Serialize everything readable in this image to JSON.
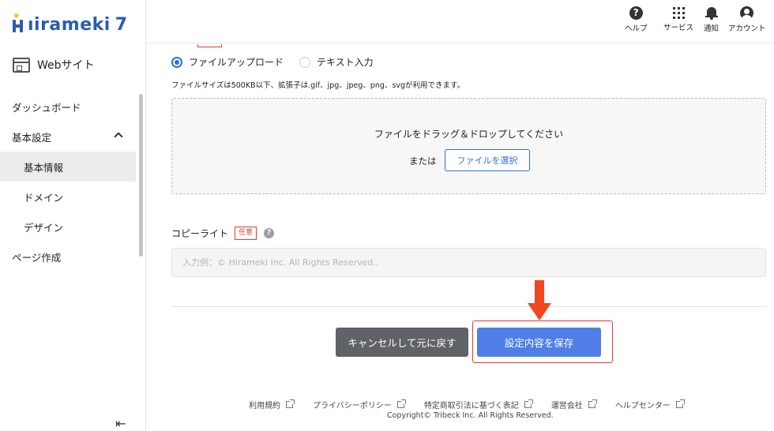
{
  "brand": {
    "logo_text": "ıirameki",
    "logo_number": "7"
  },
  "sidebar": {
    "site_label": "Webサイト",
    "items": [
      {
        "label": "ダッシュボード"
      },
      {
        "label": "基本設定"
      },
      {
        "label": "基本情報"
      },
      {
        "label": "ドメイン"
      },
      {
        "label": "デザイン"
      },
      {
        "label": "ページ作成"
      }
    ],
    "collapse_glyph": "⇤"
  },
  "header": {
    "actions": [
      {
        "label": "ヘルプ",
        "icon": "help-icon"
      },
      {
        "label": "サービス",
        "icon": "grid-icon"
      },
      {
        "label": "通知",
        "icon": "bell-icon"
      },
      {
        "label": "アカウント",
        "icon": "account-icon"
      }
    ]
  },
  "upload": {
    "option_file": "ファイルアップロード",
    "option_text": "テキスト入力",
    "selected": "ファイルアップロード",
    "note": "ファイルサイズは500KB以下、拡張子は.gif、jpg、jpeg、png、svgが利用できます。",
    "drop_title": "ファイルをドラッグ＆ドロップしてください",
    "or_text": "または",
    "select_button": "ファイルを選択"
  },
  "copyright_field": {
    "label": "コピーライト",
    "badge": "任意",
    "help_glyph": "?",
    "placeholder": "入力例：© Hirameki Inc. All Rights Reserved..",
    "value": ""
  },
  "actions": {
    "cancel": "キャンセルして元に戻す",
    "save": "設定内容を保存"
  },
  "footer": {
    "links": [
      {
        "label": "利用規約"
      },
      {
        "label": "プライバシーポリシー"
      },
      {
        "label": "特定商取引法に基づく表記"
      },
      {
        "label": "運営会社"
      },
      {
        "label": "ヘルプセンター"
      }
    ],
    "copyright": "Copyright© Tribeck Inc. All Rights Reserved."
  },
  "colors": {
    "brand": "#2a5db0",
    "accent": "#2f6fde",
    "primary_button": "#4f7fe6",
    "secondary_button": "#5f6368",
    "annotation": "#f0471f",
    "badge": "#e53935"
  }
}
